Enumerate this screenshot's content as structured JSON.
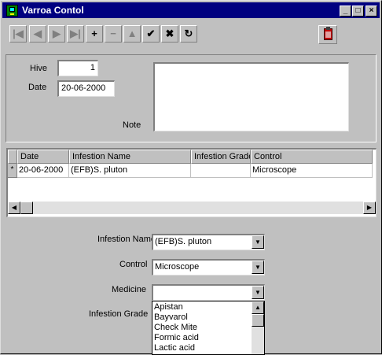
{
  "window": {
    "title": "Varroa Contol"
  },
  "caption_buttons": {
    "minimize": "_",
    "maximize": "□",
    "close": "×"
  },
  "toolbar": {
    "first": "|◀",
    "prev": "◀",
    "next": "▶",
    "last": "▶|",
    "add": "+",
    "delete": "−",
    "edit": "▲",
    "post": "✔",
    "cancel": "✖",
    "refresh": "↻"
  },
  "form": {
    "hive_label": "Hive",
    "hive_value": "1",
    "date_label": "Date",
    "date_value": "20-06-2000",
    "note_label": "Note",
    "note_value": ""
  },
  "grid": {
    "columns": [
      "Date",
      "Infestion Name",
      "Infestion Grade",
      "Control"
    ],
    "rows": [
      {
        "marker": "*",
        "date": "20-06-2000",
        "name": "(EFB)S. pluton",
        "grade": "",
        "control": "Microscope"
      }
    ]
  },
  "detail": {
    "infestion_name_label": "Infestion Name",
    "infestion_name_value": "(EFB)S. pluton",
    "control_label": "Control",
    "control_value": "Microscope",
    "medicine_label": "Medicine",
    "medicine_value": "",
    "infestion_grade_label": "Infestion Grade"
  },
  "medicine_options": [
    "Apistan",
    "Bayvarol",
    "Check Mite",
    "Formic acid",
    "Lactic acid"
  ]
}
